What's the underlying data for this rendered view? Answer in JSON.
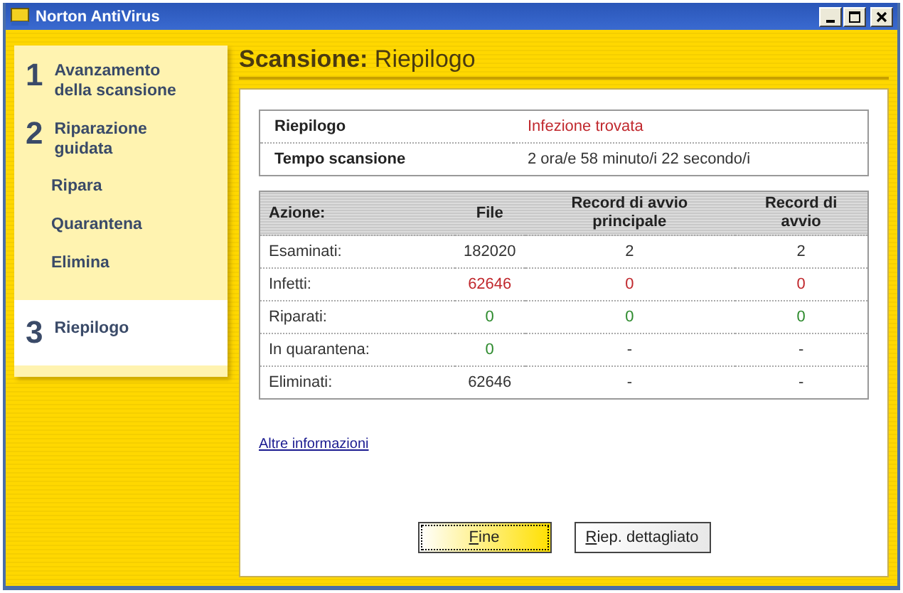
{
  "window": {
    "title": "Norton AntiVirus"
  },
  "sidebar": {
    "items": [
      {
        "kind": "step",
        "number": "1",
        "label": "Avanzamento della scansione",
        "selected": false
      },
      {
        "kind": "step",
        "number": "2",
        "label": "Riparazione guidata",
        "selected": false
      },
      {
        "kind": "substep",
        "label": "Ripara",
        "selected": false
      },
      {
        "kind": "substep",
        "label": "Quarantena",
        "selected": false
      },
      {
        "kind": "substep",
        "label": "Elimina",
        "selected": false
      },
      {
        "kind": "step",
        "number": "3",
        "label": "Riepilogo",
        "selected": true
      }
    ]
  },
  "heading": {
    "bold": "Scansione:",
    "rest": "Riepilogo"
  },
  "summary": [
    {
      "label": "Riepilogo",
      "value": "Infezione trovata",
      "color": "#c0282d"
    },
    {
      "label": "Tempo scansione",
      "value": "2 ora/e 58 minuto/i 22 secondo/i",
      "color": "#333333"
    }
  ],
  "table": {
    "columns": [
      "Azione:",
      "File",
      "Record di avvio principale",
      "Record di avvio"
    ],
    "rows": [
      {
        "cells": [
          {
            "text": "Esaminati:",
            "color": "#333333"
          },
          {
            "text": "182020",
            "color": "#333333"
          },
          {
            "text": "2",
            "color": "#333333"
          },
          {
            "text": "2",
            "color": "#333333"
          }
        ]
      },
      {
        "cells": [
          {
            "text": "Infetti:",
            "color": "#333333"
          },
          {
            "text": "62646",
            "color": "#c0282d"
          },
          {
            "text": "0",
            "color": "#c0282d"
          },
          {
            "text": "0",
            "color": "#c0282d"
          }
        ]
      },
      {
        "cells": [
          {
            "text": "Riparati:",
            "color": "#333333"
          },
          {
            "text": "0",
            "color": "#2e8b2e"
          },
          {
            "text": "0",
            "color": "#2e8b2e"
          },
          {
            "text": "0",
            "color": "#2e8b2e"
          }
        ]
      },
      {
        "cells": [
          {
            "text": "In quarantena:",
            "color": "#333333"
          },
          {
            "text": "0",
            "color": "#2e8b2e"
          },
          {
            "text": "-",
            "color": "#333333"
          },
          {
            "text": "-",
            "color": "#333333"
          }
        ]
      },
      {
        "cells": [
          {
            "text": "Eliminati:",
            "color": "#333333"
          },
          {
            "text": "62646",
            "color": "#333333"
          },
          {
            "text": "-",
            "color": "#333333"
          },
          {
            "text": "-",
            "color": "#333333"
          }
        ]
      }
    ]
  },
  "link": "Altre informazioni",
  "buttons": [
    {
      "accel": "F",
      "rest": "ine",
      "default": true
    },
    {
      "accel": "R",
      "rest": "iep. dettagliato",
      "default": false
    }
  ]
}
